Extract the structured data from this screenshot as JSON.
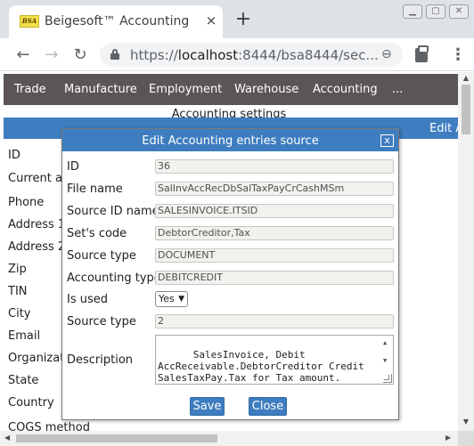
{
  "browser": {
    "tab_title": "Beigesoft™ Accounting",
    "favicon_text": "BSA",
    "url_scheme": "https://",
    "url_host": "localhost",
    "url_rest": ":8444/bsa8444/sec...",
    "tab_close": "×",
    "new_tab": "+",
    "back": "←",
    "forward": "→",
    "reload": "↻",
    "zoom": "⊖",
    "menu": "⋮"
  },
  "app_nav": {
    "items": [
      {
        "label": "Trade"
      },
      {
        "label": "Manufacture"
      },
      {
        "label": "Employment"
      },
      {
        "label": "Warehouse"
      },
      {
        "label": "Accounting"
      },
      {
        "label": "..."
      }
    ]
  },
  "background": {
    "settings_title": "Accounting settings",
    "edit_label": "Edit A",
    "field_labels": [
      "ID",
      "Current ac",
      "Phone",
      "Address 1",
      "Address 2",
      "Zip",
      "TIN",
      "City",
      "Email",
      "Organizatio",
      "State",
      "Country",
      "COGS method"
    ]
  },
  "dialog": {
    "title": "Edit Accounting entries source",
    "close_label": "x",
    "fields": {
      "id": {
        "label": "ID",
        "value": "36"
      },
      "file_name": {
        "label": "File name",
        "value": "SalInvAccRecDbSalTaxPayCrCashMSm"
      },
      "source_id_name": {
        "label": "Source ID name",
        "value": "SALESINVOICE.ITSID"
      },
      "sets_code": {
        "label": "Set's code",
        "value": "DebtorCreditor,Tax"
      },
      "source_type": {
        "label": "Source type",
        "value": "DOCUMENT"
      },
      "accounting_type": {
        "label": "Accounting type",
        "value": "DEBITCREDIT"
      },
      "is_used": {
        "label": "Is used",
        "value": "Yes",
        "caret": "▼"
      },
      "source_type_2": {
        "label": "Source type",
        "value": "2"
      },
      "description": {
        "label": "Description",
        "value": "SalesInvoice, Debit\nAccReceivable.DebtorCreditor Credit\nSalesTaxPay.Tax for Tax amount.\nCash Symmetric."
      }
    },
    "save_label": "Save",
    "close_button_label": "Close"
  }
}
